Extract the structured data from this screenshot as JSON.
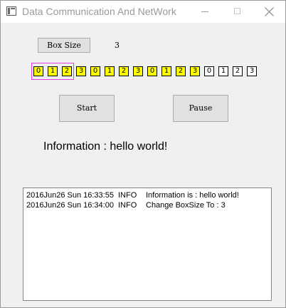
{
  "window": {
    "title": "Data Communication And NetWork"
  },
  "controls": {
    "boxsize_button": "Box Size",
    "boxsize_value": "3",
    "start_button": "Start",
    "pause_button": "Pause"
  },
  "sequence": [
    {
      "label": "0",
      "state": "sent"
    },
    {
      "label": "1",
      "state": "sent"
    },
    {
      "label": "2",
      "state": "sent"
    },
    {
      "label": "3",
      "state": "sent"
    },
    {
      "label": "0",
      "state": "sent"
    },
    {
      "label": "1",
      "state": "sent"
    },
    {
      "label": "2",
      "state": "sent"
    },
    {
      "label": "3",
      "state": "sent"
    },
    {
      "label": "0",
      "state": "sent"
    },
    {
      "label": "1",
      "state": "sent"
    },
    {
      "label": "2",
      "state": "sent"
    },
    {
      "label": "3",
      "state": "sent"
    },
    {
      "label": "0",
      "state": "pending"
    },
    {
      "label": "1",
      "state": "pending"
    },
    {
      "label": "2",
      "state": "pending"
    },
    {
      "label": "3",
      "state": "pending"
    }
  ],
  "information": "Information : hello world!",
  "log": [
    {
      "timestamp": "2016Jun26 Sun  16:33:55",
      "level": "INFO",
      "message": "Information is : hello world!"
    },
    {
      "timestamp": "2016Jun26 Sun  16:34:00",
      "level": "INFO",
      "message": "Change BoxSize To : 3"
    }
  ],
  "colors": {
    "sent_fill": "#ffff00",
    "pending_fill": "#ffffff",
    "window_highlight": "#e040e0"
  }
}
